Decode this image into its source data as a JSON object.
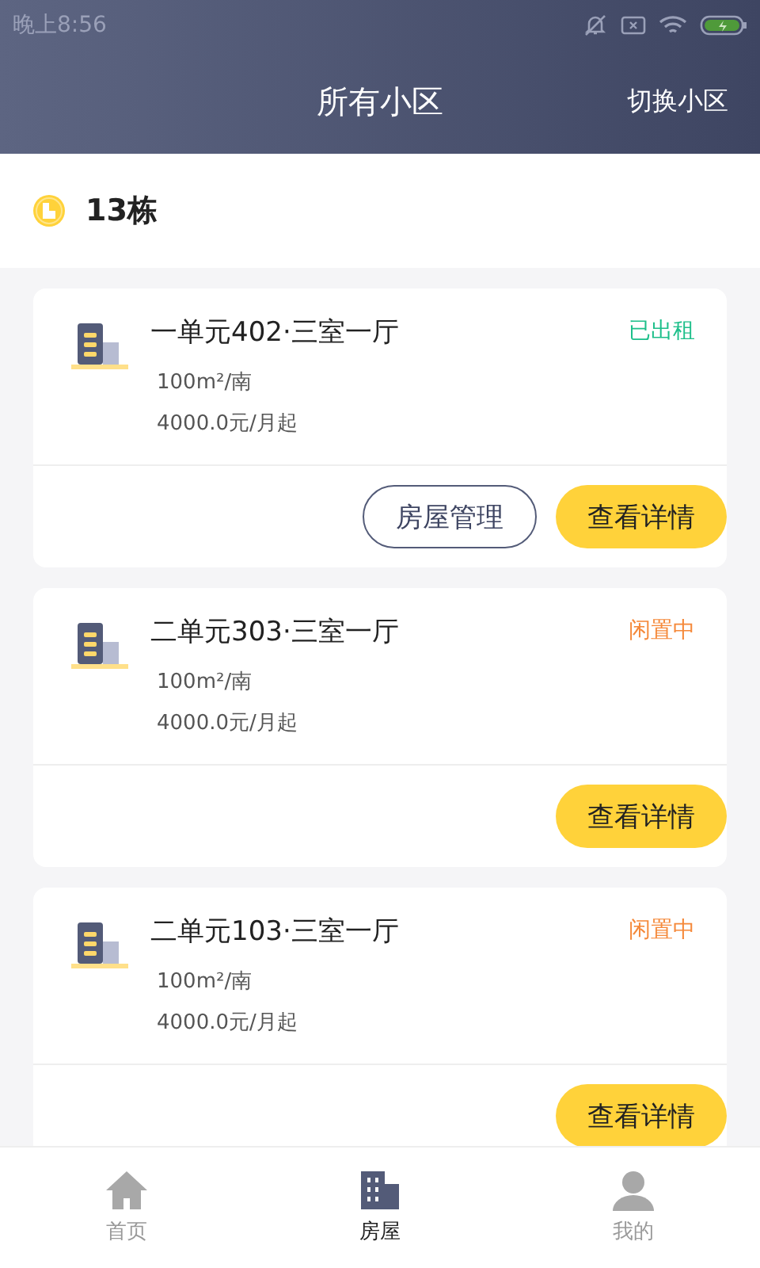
{
  "status_bar": {
    "time": "晚上8:56"
  },
  "header": {
    "title": "所有小区",
    "action": "切换小区"
  },
  "section": {
    "title": "13栋"
  },
  "houses": [
    {
      "name": "一单元402·三室一厅",
      "area": "100m²/南",
      "price": "4000.0元/月起",
      "status": {
        "label": "已出租",
        "color": "#1dbf8a"
      },
      "buttons": [
        {
          "label": "房屋管理",
          "kind": "outline"
        },
        {
          "label": "查看详情",
          "kind": "primary"
        }
      ]
    },
    {
      "name": "二单元303·三室一厅",
      "area": "100m²/南",
      "price": "4000.0元/月起",
      "status": {
        "label": "闲置中",
        "color": "#f5893a"
      },
      "buttons": [
        {
          "label": "查看详情",
          "kind": "primary"
        }
      ]
    },
    {
      "name": "二单元103·三室一厅",
      "area": "100m²/南",
      "price": "4000.0元/月起",
      "status": {
        "label": "闲置中",
        "color": "#f5893a"
      },
      "buttons": [
        {
          "label": "查看详情",
          "kind": "primary"
        }
      ]
    }
  ],
  "tabs": [
    {
      "label": "首页",
      "kind": "home",
      "selected": false
    },
    {
      "label": "房屋",
      "kind": "building",
      "selected": true
    },
    {
      "label": "我的",
      "kind": "person",
      "selected": false
    }
  ]
}
